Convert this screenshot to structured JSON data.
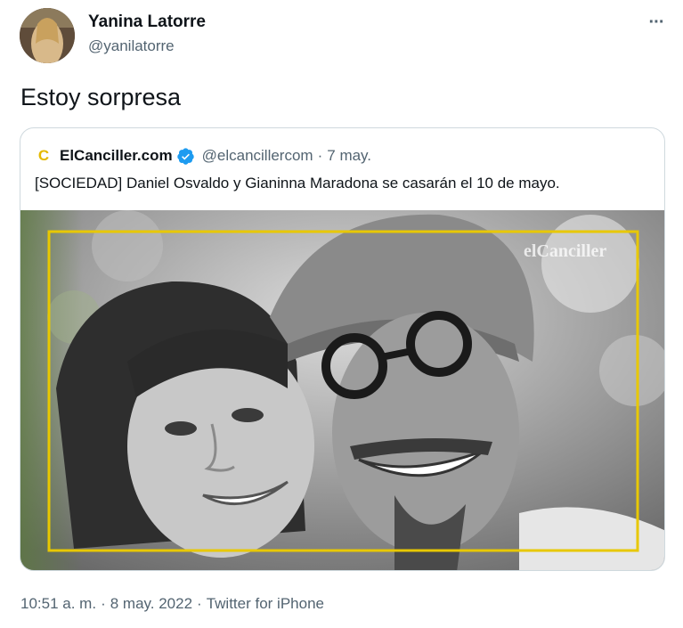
{
  "author": {
    "name": "Yanina Latorre",
    "handle": "@yanilatorre"
  },
  "tweet": {
    "text": "Estoy sorpresa"
  },
  "more_button": {
    "icon": "more-horizontal-icon",
    "glyph": "···"
  },
  "quote": {
    "logo_letter": "C",
    "name": "ElCanciller.com",
    "verified_icon": "verified-badge-icon",
    "handle": "@elcancillercom",
    "separator": "·",
    "date": "7 may.",
    "text": "[SOCIEDAD] Daniel Osvaldo y Gianinna Maradona se casarán el 10 de mayo.",
    "photo": {
      "watermark": "elCanciller",
      "frame_color": "#e8c800"
    }
  },
  "footer": {
    "time": "10:51 a. m.",
    "date": "8 may. 2022",
    "source": "Twitter for iPhone",
    "separator": "·"
  },
  "colors": {
    "text_primary": "#0f1419",
    "text_secondary": "#536471",
    "verified": "#1d9bf0",
    "card_border": "#cfd9de",
    "logo_yellow": "#e4b900"
  }
}
